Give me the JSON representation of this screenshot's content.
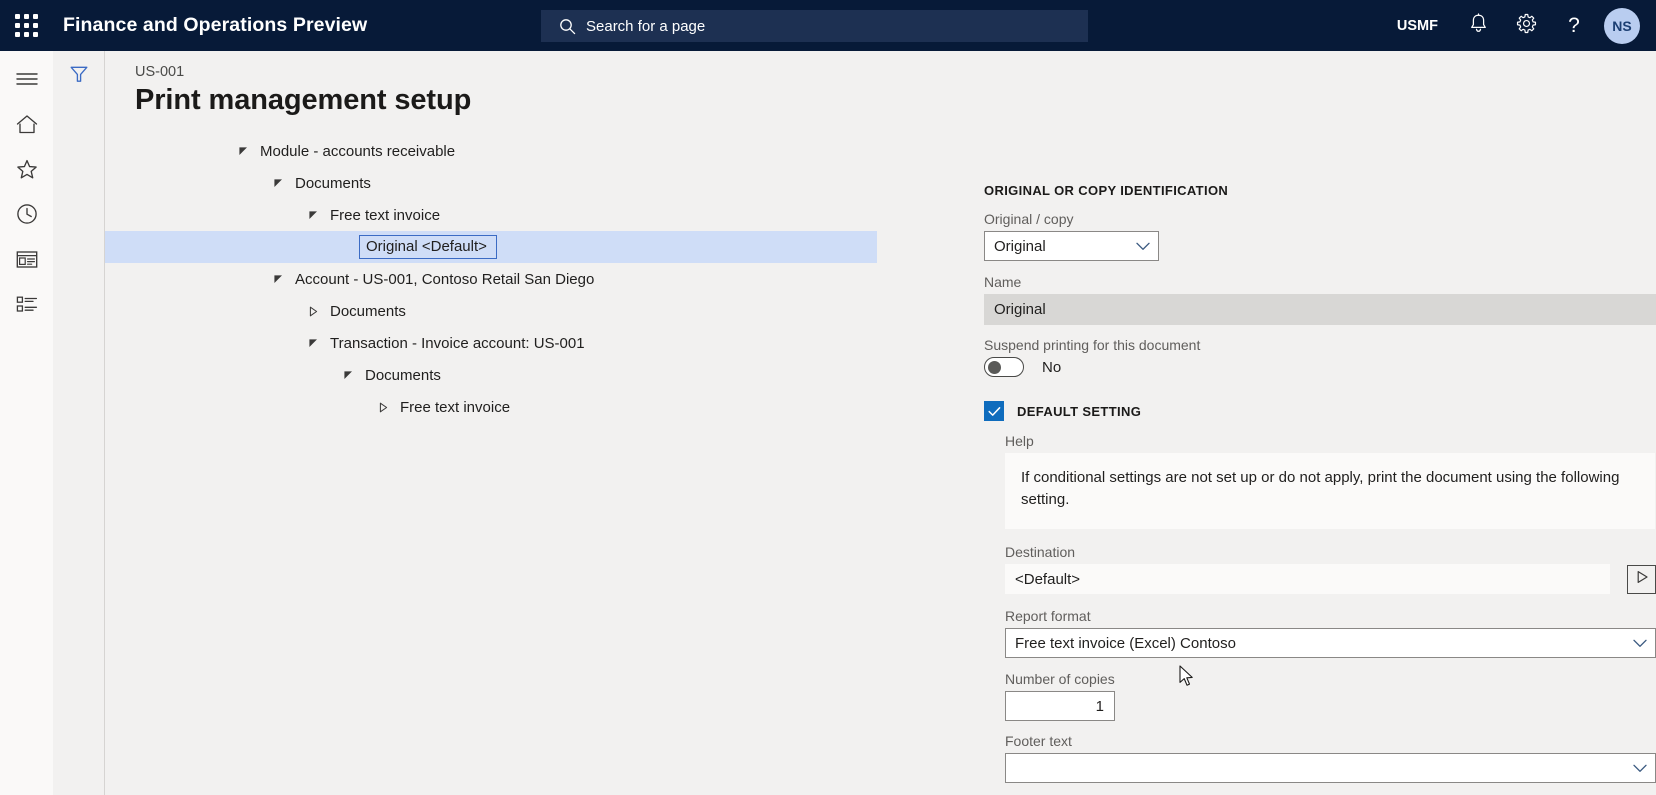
{
  "topbar": {
    "waffle_icon": "app-launcher-icon",
    "app_title": "Finance and Operations Preview",
    "search": {
      "icon": "search-icon",
      "placeholder": "Search for a page",
      "value": ""
    },
    "company": "USMF",
    "notifications_icon": "bell-icon",
    "settings_icon": "gear-icon",
    "help_icon": "question-mark-icon",
    "help_glyph": "?",
    "avatar_initials": "NS"
  },
  "leftrail": {
    "items": [
      {
        "name": "hamburger-menu-icon",
        "label": "Expand the navigation pane"
      },
      {
        "name": "home-icon",
        "label": "Home"
      },
      {
        "name": "star-icon",
        "label": "Favorites"
      },
      {
        "name": "clock-icon",
        "label": "Recent"
      },
      {
        "name": "workspaces-icon",
        "label": "Workspaces"
      },
      {
        "name": "modules-list-icon",
        "label": "Modules"
      }
    ]
  },
  "filterpane": {
    "filter_icon": "filter-funnel-icon",
    "filter_label": "Show filters"
  },
  "page": {
    "breadcrumb": "US-001",
    "title": "Print management setup"
  },
  "tree": {
    "nodes": [
      {
        "label": "Module - accounts receivable",
        "indent": 0,
        "state": "expanded",
        "selected": false
      },
      {
        "label": "Documents",
        "indent": 1,
        "state": "expanded",
        "selected": false
      },
      {
        "label": "Free text invoice",
        "indent": 2,
        "state": "expanded",
        "selected": false
      },
      {
        "label": "Original <Default>",
        "indent": 3,
        "state": "leaf",
        "selected": true
      },
      {
        "label": "Account - US-001, Contoso Retail San Diego",
        "indent": 1,
        "state": "expanded",
        "selected": false
      },
      {
        "label": "Documents",
        "indent": 2,
        "state": "collapsed",
        "selected": false
      },
      {
        "label": "Transaction - Invoice account: US-001",
        "indent": 2,
        "state": "expanded",
        "selected": false
      },
      {
        "label": "Documents",
        "indent": 3,
        "state": "expanded",
        "selected": false
      },
      {
        "label": "Free text invoice",
        "indent": 4,
        "state": "collapsed",
        "selected": false
      }
    ]
  },
  "details": {
    "section_title": "ORIGINAL OR COPY IDENTIFICATION",
    "original_copy": {
      "label": "Original / copy",
      "value": "Original",
      "chevron_icon": "chevron-down-icon"
    },
    "name": {
      "label": "Name",
      "value": "Original"
    },
    "suspend": {
      "label": "Suspend printing for this document",
      "state_text": "No",
      "checked": false
    },
    "default_setting": {
      "label": "DEFAULT SETTING",
      "checked": true,
      "check_glyph": "✓",
      "help": {
        "label": "Help",
        "text": "If conditional settings are not set up or do not apply, print the document using the following setting."
      },
      "destination": {
        "label": "Destination",
        "value": "<Default>",
        "run_button_icon": "play-triangle-icon",
        "run_button_label": "Open destination settings"
      },
      "report_format": {
        "label": "Report format",
        "value": "Free text invoice (Excel) Contoso",
        "chevron_icon": "chevron-down-icon"
      },
      "number_of_copies": {
        "label": "Number of copies",
        "value": "1"
      },
      "footer_text": {
        "label": "Footer text",
        "value": "",
        "chevron_icon": "chevron-down-icon"
      }
    }
  },
  "colors": {
    "header_bg": "#071a38",
    "search_bg": "#1d3052",
    "page_bg": "#f2f1f0",
    "accent_blue": "#0f6cbd",
    "selection_blue": "#cfddf7",
    "selection_border": "#3b6bc4",
    "readonly_gray": "#d8d7d5",
    "avatar_bg": "#b9cdf0"
  }
}
